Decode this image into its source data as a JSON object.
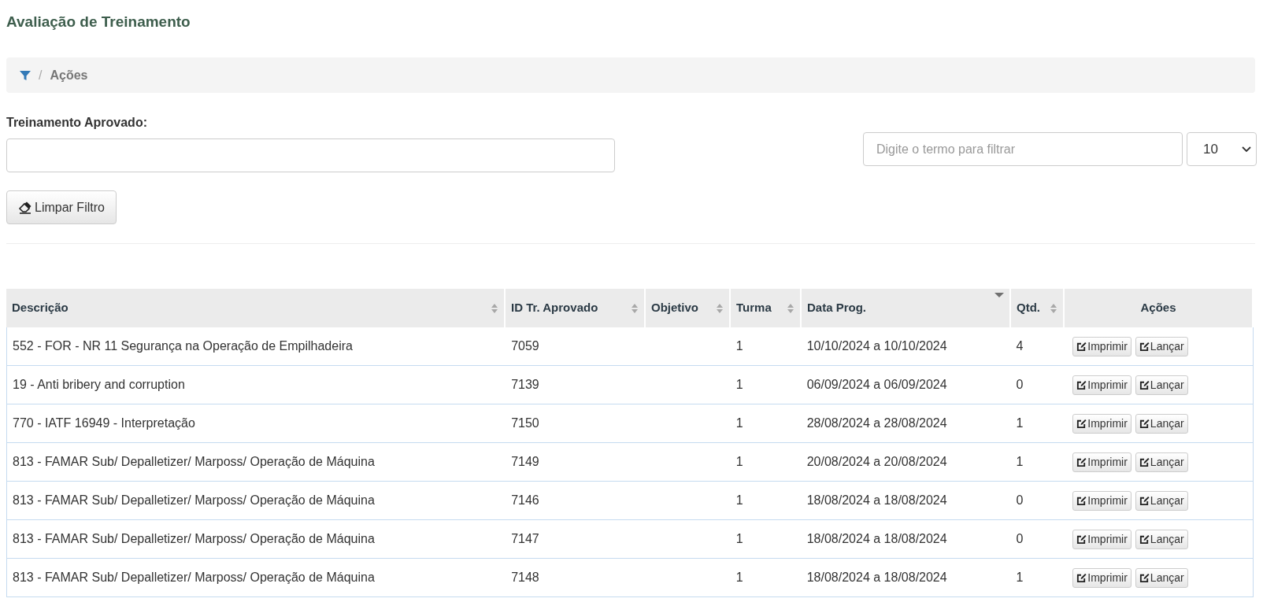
{
  "page_title": "Avaliação de Treinamento",
  "breadcrumb": {
    "separator": "/",
    "items": [
      "Ações"
    ]
  },
  "filter": {
    "label": "Treinamento Aprovado:"
  },
  "clear_button": "Limpar Filtro",
  "search": {
    "placeholder": "Digite o termo para filtrar"
  },
  "page_size": "10",
  "table": {
    "columns": [
      {
        "label": "Descrição",
        "sortable": true,
        "sorted_descending": false
      },
      {
        "label": "ID Tr. Aprovado",
        "sortable": true,
        "sorted_descending": false
      },
      {
        "label": "Objetivo",
        "sortable": true,
        "sorted_descending": false
      },
      {
        "label": "Turma",
        "sortable": true,
        "sorted_descending": false
      },
      {
        "label": "Data Prog.",
        "sortable": true,
        "sorted_descending": true
      },
      {
        "label": "Qtd.",
        "sortable": true,
        "sorted_descending": false
      },
      {
        "label": "Ações",
        "sortable": false
      }
    ],
    "rows": [
      {
        "cells": [
          "552 - FOR - NR 11 Segurança na Operação de Empilhadeira",
          "7059",
          "",
          "1",
          "10/10/2024 a 10/10/2024",
          "4"
        ],
        "actions": [
          "Imprimir",
          "Lançar"
        ]
      },
      {
        "cells": [
          "19 - Anti bribery and corruption",
          "7139",
          "",
          "1",
          "06/09/2024 a 06/09/2024",
          "0"
        ],
        "actions": [
          "Imprimir",
          "Lançar"
        ]
      },
      {
        "cells": [
          "770 - IATF 16949 - Interpretação",
          "7150",
          "",
          "1",
          "28/08/2024 a 28/08/2024",
          "1"
        ],
        "actions": [
          "Imprimir",
          "Lançar"
        ]
      },
      {
        "cells": [
          "813 - FAMAR Sub/ Depalletizer/ Marposs/ Operação de Máquina",
          "7149",
          "",
          "1",
          "20/08/2024 a 20/08/2024",
          "1"
        ],
        "actions": [
          "Imprimir",
          "Lançar"
        ]
      },
      {
        "cells": [
          "813 - FAMAR Sub/ Depalletizer/ Marposs/ Operação de Máquina",
          "7146",
          "",
          "1",
          "18/08/2024 a 18/08/2024",
          "0"
        ],
        "actions": [
          "Imprimir",
          "Lançar"
        ]
      },
      {
        "cells": [
          "813 - FAMAR Sub/ Depalletizer/ Marposs/ Operação de Máquina",
          "7147",
          "",
          "1",
          "18/08/2024 a 18/08/2024",
          "0"
        ],
        "actions": [
          "Imprimir",
          "Lançar"
        ]
      },
      {
        "cells": [
          "813 - FAMAR Sub/ Depalletizer/ Marposs/ Operação de Máquina",
          "7148",
          "",
          "1",
          "18/08/2024 a 18/08/2024",
          "1"
        ],
        "actions": [
          "Imprimir",
          "Lançar"
        ]
      }
    ]
  }
}
